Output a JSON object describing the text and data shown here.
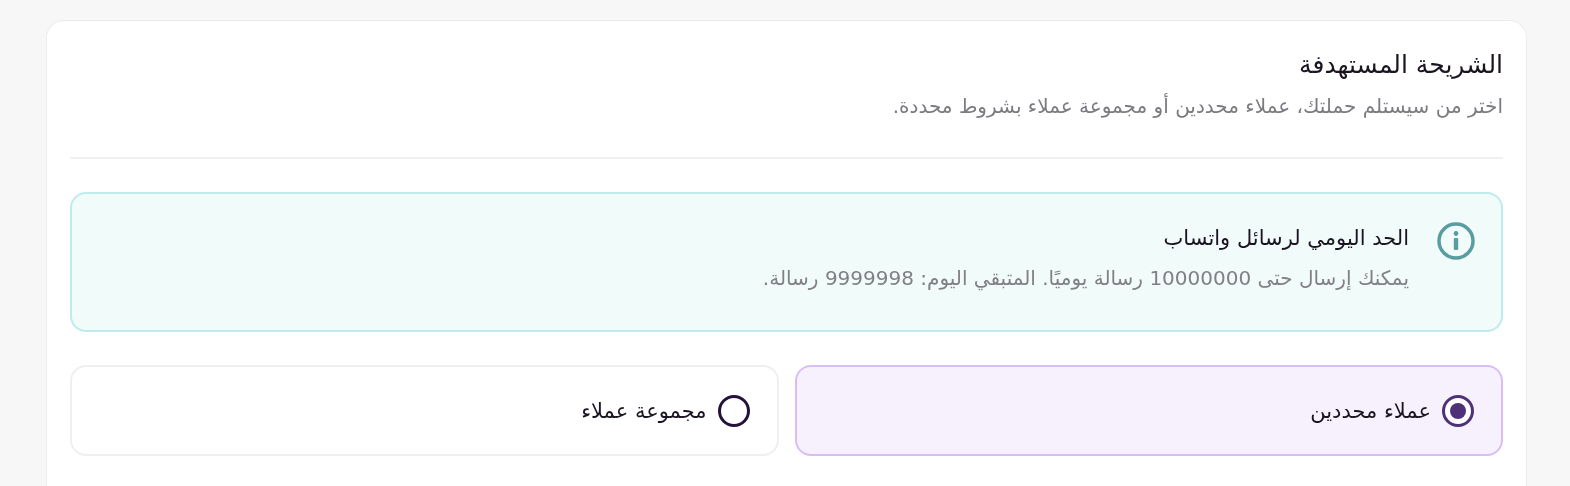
{
  "section": {
    "title": "الشريحة المستهدفة",
    "subtitle": "اختر من سيستلم حملتك، عملاء محددين أو مجموعة عملاء بشروط محددة."
  },
  "notice": {
    "title": "الحد اليومي لرسائل واتساب",
    "message": "يمكنك إرسال حتى 10000000 رسالة يوميًا. المتبقي اليوم: 9999998 رسالة."
  },
  "options": [
    {
      "label": "عملاء محددين",
      "selected": true
    },
    {
      "label": "مجموعة عملاء",
      "selected": false
    }
  ]
}
